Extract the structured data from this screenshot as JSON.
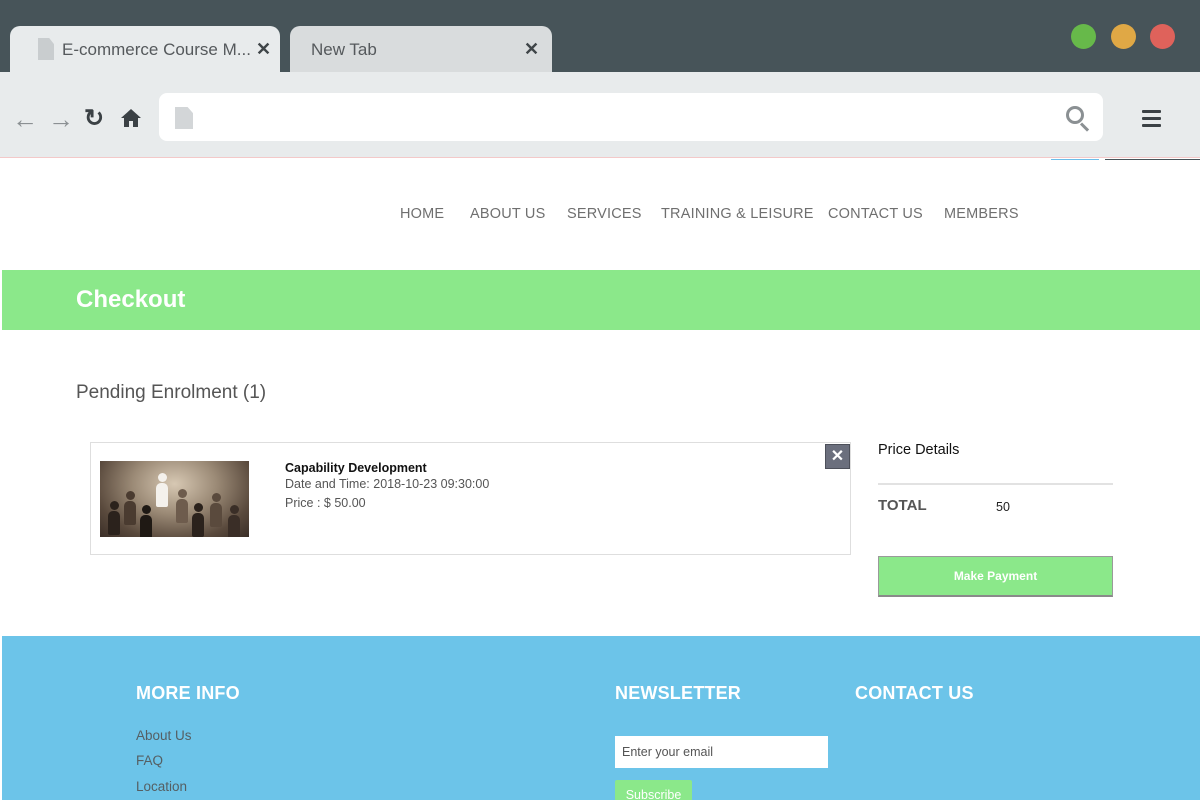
{
  "browser": {
    "tabs": [
      {
        "title": "E-commerce Course M..."
      },
      {
        "title": "New Tab"
      }
    ],
    "address_placeholder": "",
    "window_controls": {
      "green": "#67b94a",
      "yellow": "#e0a845",
      "red": "#df625b"
    },
    "icons": {
      "back": "arrow-left-icon",
      "forward": "arrow-right-icon",
      "reload": "reload-icon",
      "home": "home-icon",
      "search": "search-icon",
      "menu": "hamburger-menu-icon"
    }
  },
  "nav": {
    "items": [
      "HOME",
      "ABOUT US",
      "SERVICES",
      "TRAINING & LEISURE",
      "CONTACT US",
      "MEMBERS"
    ]
  },
  "page_title": "Checkout",
  "pending": {
    "title": "Pending Enrolment (1)",
    "item": {
      "name": "Capability Development",
      "date_time": "Date and Time: 2018-10-23 09:30:00",
      "price": "Price : $ 50.00",
      "remove_label": "✕"
    }
  },
  "price_details": {
    "heading": "Price Details",
    "total_label": "TOTAL",
    "total_value": "50",
    "pay_button": "Make Payment"
  },
  "footer": {
    "more_info": {
      "heading": "MORE INFO",
      "links": [
        "About Us",
        "FAQ",
        "Location"
      ]
    },
    "newsletter": {
      "heading": "NEWSLETTER",
      "email_placeholder": "Enter your email",
      "subscribe": "Subscribe"
    },
    "contact": {
      "heading": "CONTACT US"
    }
  },
  "colors": {
    "accent_green": "#8be88a",
    "footer_blue": "#6cc4e9",
    "chrome_dark": "#475459"
  }
}
